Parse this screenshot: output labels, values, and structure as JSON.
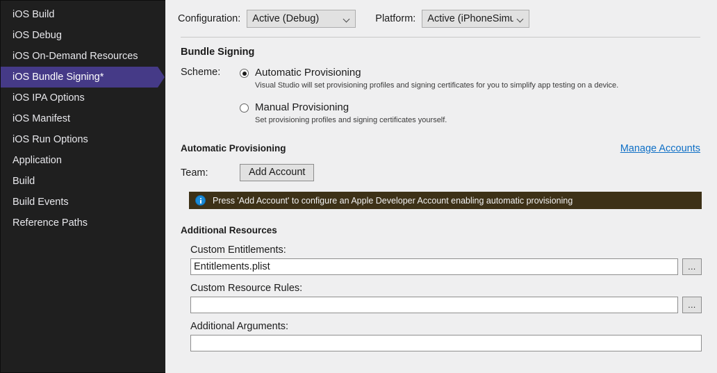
{
  "sidebar": {
    "items": [
      {
        "label": "iOS Build",
        "selected": false
      },
      {
        "label": "iOS Debug",
        "selected": false
      },
      {
        "label": "iOS On-Demand Resources",
        "selected": false
      },
      {
        "label": "iOS Bundle Signing*",
        "selected": true
      },
      {
        "label": "iOS IPA Options",
        "selected": false
      },
      {
        "label": "iOS Manifest",
        "selected": false
      },
      {
        "label": "iOS Run Options",
        "selected": false
      },
      {
        "label": "Application",
        "selected": false
      },
      {
        "label": "Build",
        "selected": false
      },
      {
        "label": "Build Events",
        "selected": false
      },
      {
        "label": "Reference Paths",
        "selected": false
      }
    ]
  },
  "config_bar": {
    "configuration_label": "Configuration:",
    "configuration_value": "Active (Debug)",
    "platform_label": "Platform:",
    "platform_value": "Active (iPhoneSimulator)"
  },
  "bundle_signing": {
    "title": "Bundle Signing",
    "scheme_label": "Scheme:",
    "options": [
      {
        "label": "Automatic Provisioning",
        "description": "Visual Studio will set provisioning profiles and signing certificates for you to simplify app testing on a device.",
        "selected": true
      },
      {
        "label": "Manual Provisioning",
        "description": "Set provisioning profiles and signing certificates yourself.",
        "selected": false
      }
    ]
  },
  "automatic_provisioning": {
    "title": "Automatic Provisioning",
    "manage_accounts_link": "Manage Accounts",
    "team_label": "Team:",
    "add_account_button": "Add Account",
    "info_message": "Press 'Add Account' to configure an Apple Developer Account enabling automatic provisioning"
  },
  "additional_resources": {
    "title": "Additional Resources",
    "fields": [
      {
        "label": "Custom Entitlements:",
        "value": "Entitlements.plist",
        "placeholder": "",
        "has_browse": true,
        "browse_label": "..."
      },
      {
        "label": "Custom Resource Rules:",
        "value": "",
        "placeholder": "",
        "has_browse": true,
        "browse_label": "..."
      },
      {
        "label": "Additional Arguments:",
        "value": "",
        "placeholder": "",
        "has_browse": false,
        "browse_label": ""
      }
    ]
  },
  "colors": {
    "sidebar_bg": "#1f1f1f",
    "selection": "#453a87",
    "content_bg": "#efeff0",
    "link": "#0e6fc6",
    "info_bar_bg": "#3d3117",
    "info_icon": "#1a8ad6"
  }
}
